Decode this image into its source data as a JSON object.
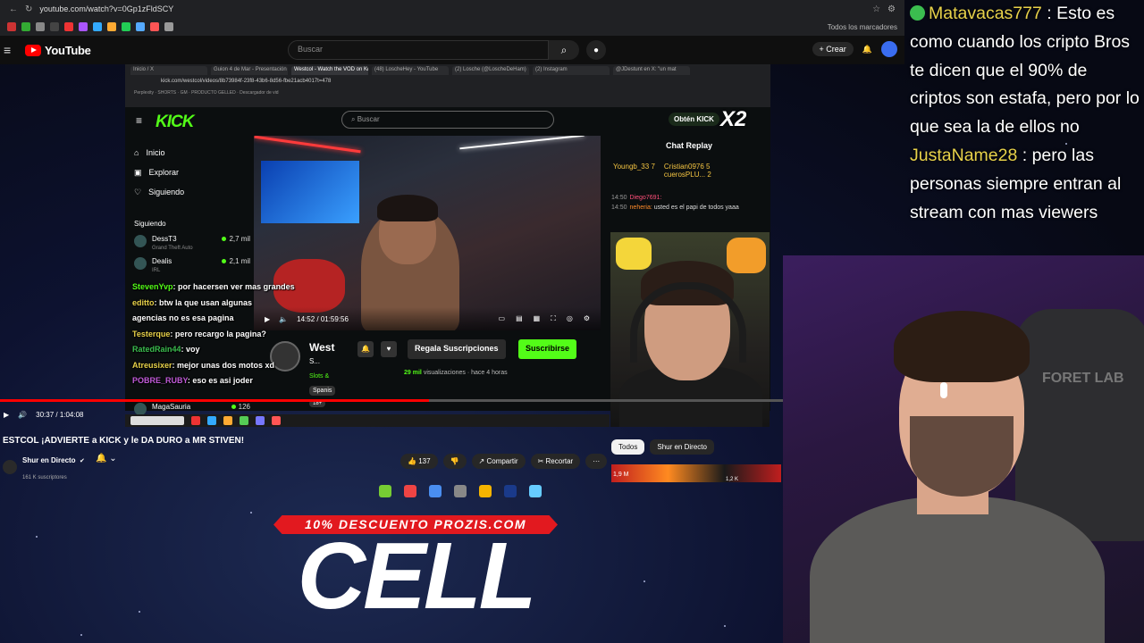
{
  "browser": {
    "url": "youtube.com/watch?v=0Gp1zFldSCY",
    "bookmarks_label": "Todos los marcadores"
  },
  "youtube": {
    "logo": "YouTube",
    "search_placeholder": "Buscar",
    "create_label": "Crear"
  },
  "inner_browser": {
    "tabs": [
      "Inicio / X",
      "Guion 4 de Mar - Presentación",
      "Westcol - Watch the VOD on Kick",
      "(48) LoscheHey - YouTube",
      "(2) Losche (@LoscheDeHam)",
      "(2) Instagram",
      "@JDestunt en X: \"un mat"
    ],
    "url": "kick.com/westcol/videos/8b73984f-23f8-43b6-8d56-fbe21acb4017t=478",
    "bookmarks": "Perplexity · SHORTS · GM · PRODUCTO GELLED · Descargador de vid"
  },
  "kick": {
    "logo": "KICK",
    "search_placeholder": "Buscar",
    "get_kick": "Obtén KICK",
    "x2": "X2",
    "nav": [
      "Inicio",
      "Explorar",
      "Siguiendo"
    ],
    "following_header": "Siguiendo",
    "following": [
      {
        "name": "DessT3",
        "game": "Grand Theft Auto",
        "count": "2,7 mil"
      },
      {
        "name": "Dealis",
        "game": "IRL",
        "count": "2,1 mil"
      },
      {
        "name": "MagaSauria",
        "game": "",
        "count": "126"
      }
    ],
    "player": {
      "time": "14:52 / 01:59:56"
    },
    "streamer": {
      "name": "West",
      "sub": "S...",
      "category": "Slots &",
      "tag": "Spanis",
      "age": "18+",
      "gift_label": "Regala Suscripciones",
      "subscribe_label": "Suscribirse",
      "views": "29 mil",
      "views_suffix": "visualizaciones",
      "ago": "hace 4 horas"
    },
    "chat": {
      "title": "Chat Replay",
      "top_users": [
        "Youngb_33",
        "Cristian0976",
        "cuerosPLU..."
      ],
      "top_counts": [
        "7",
        "5",
        "2"
      ],
      "messages": [
        {
          "time": "14:50",
          "user": "Diego7691:",
          "text": ""
        },
        {
          "time": "14:50",
          "user": "neheria:",
          "text": "usted es el papi de todos yaaa"
        }
      ]
    }
  },
  "overlay_chat": [
    {
      "user": "StevenYvp",
      "text": ": por hacersen ver mas grandes"
    },
    {
      "user": "editto",
      "text": ": btw la que usan algunas"
    },
    {
      "user": "",
      "text": "agencias no es esa pagina"
    },
    {
      "user": "Testerque",
      "text": ": pero recargo la pagina?"
    },
    {
      "user": "RatedRain44",
      "text": ": voy"
    },
    {
      "user": "Atreusixer",
      "text": ": mejor unas dos motos xd"
    },
    {
      "user": "POBRE_RUBY",
      "text": ": eso es asi joder"
    }
  ],
  "yt_player": {
    "time": "30:37 / 1:04:08"
  },
  "video": {
    "title": "ESTCOL ¡ADVIERTE a KICK y le DA DURO a MR STIVEN!",
    "channel": "Shur en Directo",
    "subscribers": "161 K suscriptores",
    "likes": "137",
    "share": "Compartir",
    "clip": "Recortar",
    "more": "···"
  },
  "chips": [
    "Todos",
    "Shur en Directo"
  ],
  "thumb_views": [
    "1,9 M",
    "1,2 K"
  ],
  "promo": {
    "banner": "10% DESCUENTO PROZIS.COM",
    "big": "CELL"
  },
  "right_chat": [
    {
      "user": "Matavacas777",
      "text": " : Esto es como cuando los cripto Bros te dicen que el 90% de criptos son estafa, pero por lo que sea la de ellos no"
    },
    {
      "user": "JustaName28",
      "text": " : pero las personas siempre entran al stream con mas viewers"
    }
  ],
  "cam2": {
    "chair_text": "FORET LAB"
  },
  "colors": {
    "kick_green": "#53fc18",
    "yt_red": "#ff0000",
    "promo_red": "#e2191f"
  }
}
